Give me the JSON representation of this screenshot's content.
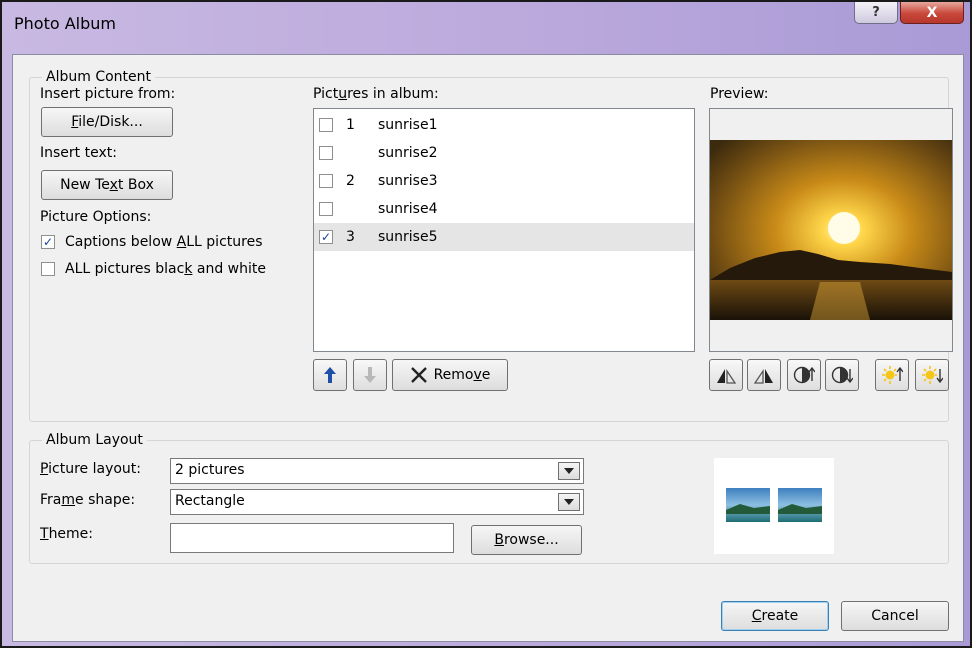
{
  "window": {
    "title": "Photo Album",
    "help_glyph": "?",
    "close_glyph": "X"
  },
  "album_content": {
    "legend": "Album Content",
    "insert_picture_label": "Insert picture from:",
    "file_disk_button": {
      "prefix": "",
      "mnemonic": "F",
      "rest": "ile/Disk..."
    },
    "insert_text_label": "Insert text:",
    "new_text_box_button": {
      "prefix": "New Te",
      "mnemonic": "x",
      "rest": "t Box"
    },
    "picture_options_label": "Picture Options:",
    "captions_option": {
      "prefix": "Captions below ",
      "mnemonic": "A",
      "rest": "LL pictures",
      "checked": true
    },
    "bw_option": {
      "prefix": "ALL pictures blac",
      "mnemonic": "k",
      "rest": " and white",
      "checked": false
    },
    "pictures_in_album_label": {
      "prefix": "Pict",
      "mnemonic": "u",
      "rest": "res in album:"
    },
    "pictures": [
      {
        "num": "1",
        "name": "sunrise1",
        "checked": false,
        "selected": false
      },
      {
        "num": "",
        "name": "sunrise2",
        "checked": false,
        "selected": false
      },
      {
        "num": "2",
        "name": "sunrise3",
        "checked": false,
        "selected": false
      },
      {
        "num": "",
        "name": "sunrise4",
        "checked": false,
        "selected": false
      },
      {
        "num": "3",
        "name": "sunrise5",
        "checked": true,
        "selected": true
      }
    ],
    "remove_button": {
      "prefix": "Remo",
      "mnemonic": "v",
      "rest": "e"
    },
    "preview_label": "Preview:"
  },
  "album_layout": {
    "legend": "Album Layout",
    "picture_layout_label": {
      "prefix": "",
      "mnemonic": "P",
      "rest": "icture layout:"
    },
    "picture_layout_value": "2 pictures",
    "frame_shape_label": {
      "prefix": "Fra",
      "mnemonic": "m",
      "rest": "e shape:"
    },
    "frame_shape_value": "Rectangle",
    "theme_label": {
      "prefix": "",
      "mnemonic": "T",
      "rest": "heme:"
    },
    "theme_value": "",
    "browse_button": {
      "prefix": "",
      "mnemonic": "B",
      "rest": "rowse..."
    }
  },
  "footer": {
    "create_button": {
      "prefix": "",
      "mnemonic": "C",
      "rest": "reate"
    },
    "cancel_button": "Cancel"
  },
  "icons": {
    "move_up": "arrow-up-icon",
    "move_down": "arrow-down-icon",
    "remove": "x-mark-icon",
    "rotate_left": "rotate-left-icon",
    "rotate_right": "rotate-right-icon",
    "more_contrast": "increase-contrast-icon",
    "less_contrast": "decrease-contrast-icon",
    "more_brightness": "increase-brightness-icon",
    "less_brightness": "decrease-brightness-icon"
  },
  "colors": {
    "title_bar": "#bba9dc",
    "close_button": "#c9473b",
    "dialog_bg": "#f0f0f0",
    "arrow_blue": "#1f4fa8"
  }
}
